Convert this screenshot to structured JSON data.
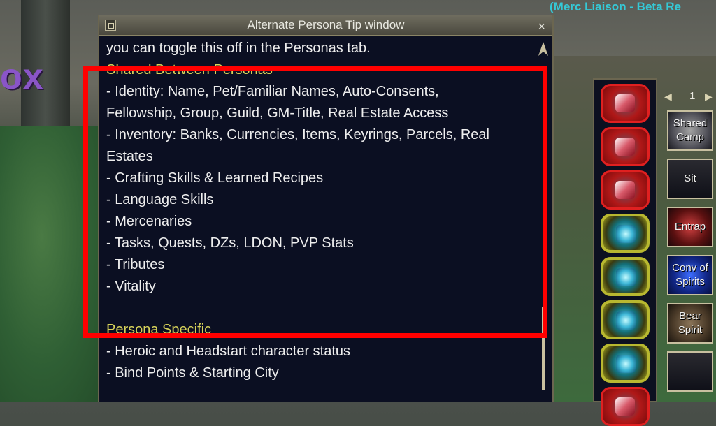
{
  "scene": {
    "zone_text": "ox",
    "merc_label": "(Merc Liaison - Beta Re"
  },
  "tip_window": {
    "title": "Alternate Persona Tip window",
    "close_label": "×",
    "lines": [
      {
        "text": "you can toggle this off in the Personas tab.",
        "heading": false
      },
      {
        "text": "Shared Between Personas",
        "heading": true
      },
      {
        "text": "- Identity: Name, Pet/Familiar Names, Auto-Consents,",
        "heading": false
      },
      {
        "text": "Fellowship, Group, Guild, GM-Title, Real Estate Access",
        "heading": false
      },
      {
        "text": "- Inventory: Banks, Currencies, Items, Keyrings, Parcels, Real",
        "heading": false
      },
      {
        "text": "Estates",
        "heading": false
      },
      {
        "text": "- Crafting Skills & Learned Recipes",
        "heading": false
      },
      {
        "text": "- Language Skills",
        "heading": false
      },
      {
        "text": "- Mercenaries",
        "heading": false
      },
      {
        "text": "- Tasks, Quests, DZs, LDON, PVP Stats",
        "heading": false
      },
      {
        "text": "- Tributes",
        "heading": false
      },
      {
        "text": "- Vitality",
        "heading": false
      },
      {
        "text": "",
        "heading": false
      },
      {
        "text": "Persona Specific",
        "heading": true
      },
      {
        "text": "- Heroic and Headstart character status",
        "heading": false
      },
      {
        "text": "- Bind Points & Starting City",
        "heading": false
      }
    ]
  },
  "spell_gems": [
    {
      "style": "red",
      "icon": "crystal-spell-icon"
    },
    {
      "style": "red",
      "icon": "heart-gem-spell-icon"
    },
    {
      "style": "red",
      "icon": "heart-gem-spell-icon"
    },
    {
      "style": "green",
      "icon": "empty-spell-gem-icon"
    },
    {
      "style": "green",
      "icon": "empty-spell-gem-icon"
    },
    {
      "style": "green",
      "icon": "empty-spell-gem-icon"
    },
    {
      "style": "green",
      "icon": "empty-spell-gem-icon"
    },
    {
      "style": "red",
      "icon": "spell-gem-icon"
    }
  ],
  "hotbar": {
    "page_number": "1",
    "buttons": [
      {
        "label": "Shared Camp",
        "style": "img-grey"
      },
      {
        "label": "Sit",
        "style": ""
      },
      {
        "label": "Entrap",
        "style": "img-red"
      },
      {
        "label": "Conv of Spirits",
        "style": "img-blue"
      },
      {
        "label": "Bear Spirit",
        "style": "img-bear"
      },
      {
        "label": "",
        "style": ""
      }
    ]
  },
  "colors": {
    "highlight": "#ff0000",
    "heading": "#d8d35a",
    "merc_text": "#35c9d6"
  }
}
